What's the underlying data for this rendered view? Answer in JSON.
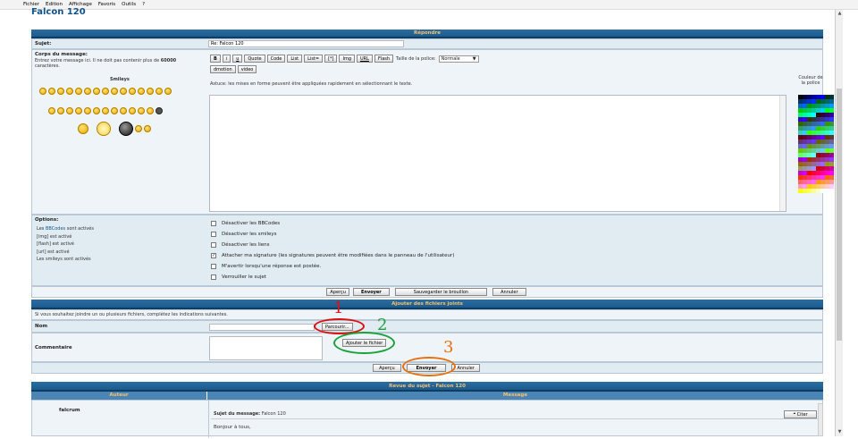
{
  "menu": [
    "Fichier",
    "Edition",
    "Affichage",
    "Favoris",
    "Outils",
    "?"
  ],
  "page_title": "Falcon 120",
  "reply": {
    "header": "Répondre",
    "subject_label": "Sujet:",
    "subject_value": "Re: Falcon 120",
    "body_label": "Corps du message:",
    "body_hint": "Entrez votre message ici. Il ne doit pas contenir plus de",
    "body_hint_count": "60000",
    "body_hint_end": "caractères.",
    "smileys_label": "Smileys",
    "format_buttons": [
      "B",
      "i",
      "u",
      "Quote",
      "Code",
      "List",
      "List=",
      "[*]",
      "Img",
      "URL",
      "Flash"
    ],
    "format_buttons_row2": [
      "dmotion",
      "video"
    ],
    "font_size_label": "Taille de la police:",
    "font_size_value": "Normale",
    "tip": "Astuce: les mises en forme peuvent être appliquées rapidement en sélectionnant le texte.",
    "color_label": "Couleur de la police",
    "options_label": "Options:",
    "options_status": [
      "Les BBCodes sont activés",
      "[img] est activé",
      "[flash] est activé",
      "[url] est activé",
      "Les smileys sont activés"
    ],
    "options_bbcodes_link": "BBCodes",
    "checkboxes": [
      {
        "label": "Désactiver les BBCodes",
        "checked": false
      },
      {
        "label": "Désactiver les smileys",
        "checked": false
      },
      {
        "label": "Désactiver les liens",
        "checked": false
      },
      {
        "label": "Attacher ma signature (les signatures peuvent être modifiées dans le panneau de l'utilisateur)",
        "checked": true
      },
      {
        "label": "M'avertir lorsqu'une réponse est postée.",
        "checked": false
      },
      {
        "label": "Verrouiller le sujet",
        "checked": false
      }
    ],
    "buttons": {
      "preview": "Aperçu",
      "send": "Envoyer",
      "save_draft": "Sauvegarder le brouillon",
      "cancel": "Annuler"
    }
  },
  "attach": {
    "header": "Ajouter des fichiers joints",
    "hint": "Si vous souhaitez joindre un ou plusieurs fichiers, complétez les indications suivantes.",
    "name_label": "Nom",
    "browse_button": "Parcourir...",
    "comment_label": "Commentaire",
    "add_file_button": "Ajouter le fichier",
    "buttons": {
      "preview": "Aperçu",
      "send": "Envoyer",
      "cancel": "Annuler"
    }
  },
  "annotations": [
    "1",
    "2",
    "3"
  ],
  "annotation_colors": {
    "one": "#e01010",
    "two": "#1aa23a",
    "three": "#e67010"
  },
  "review": {
    "header": "Revue du sujet - Falcon 120",
    "col_author": "Auteur",
    "col_message": "Message",
    "author": "falcrum",
    "subject_label": "Sujet du message:",
    "subject_value": "Falcon 120",
    "quote_button": "Citer",
    "message_start": "Bonjour à tous,"
  },
  "colors": {
    "accent": "#1d5a8c",
    "header_text": "#f5c16d",
    "row": "#e1ebf2"
  }
}
